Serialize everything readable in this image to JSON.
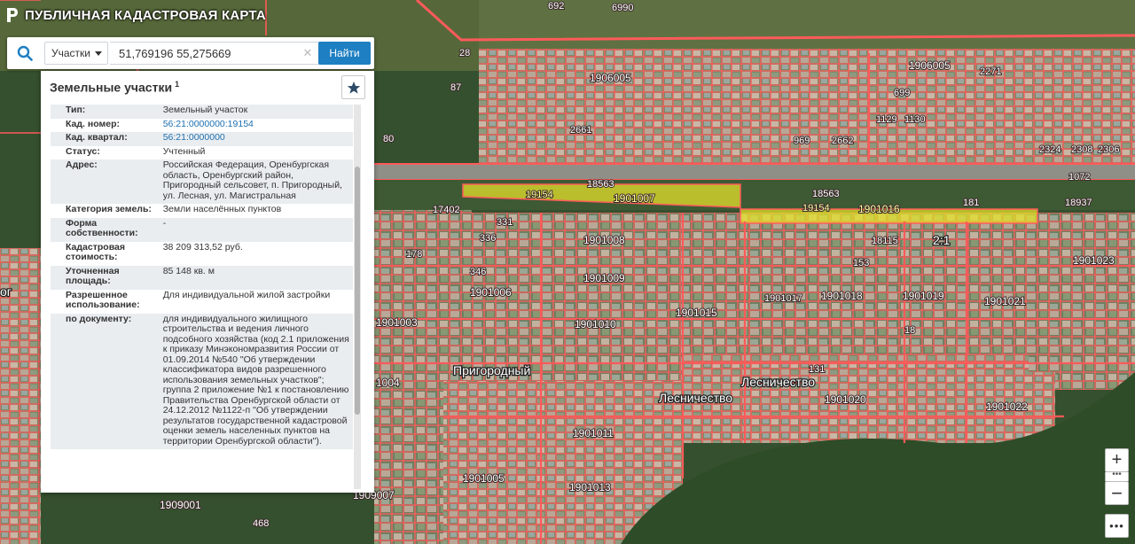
{
  "app": {
    "title": "ПУБЛИЧНАЯ КАДАСТРОВАЯ КАРТА"
  },
  "search": {
    "type_label": "Участки",
    "query": "51,769196 55,275669",
    "find_label": "Найти"
  },
  "panel": {
    "title": "Земельные участки",
    "title_sup": "1",
    "rows": [
      {
        "key": "Тип:",
        "value": "Земельный участок"
      },
      {
        "key": "Кад. номер:",
        "value": "56:21:0000000:19154",
        "link": true
      },
      {
        "key": "Кад. квартал:",
        "value": "56:21:0000000",
        "link": true
      },
      {
        "key": "Статус:",
        "value": "Учтенный"
      },
      {
        "key": "Адрес:",
        "value": "Российская Федерация, Оренбургская область, Оренбургский район, Пригородный сельсовет, п. Пригородный, ул. Лесная, ул. Магистральная"
      },
      {
        "key": "Категория земель:",
        "value": "Земли населённых пунктов"
      },
      {
        "key": "Форма собственности:",
        "value": "-"
      },
      {
        "key": "Кадастровая стоимость:",
        "value": "38 209 313,52 руб."
      },
      {
        "key": "Уточненная площадь:",
        "value": "85 148 кв. м"
      },
      {
        "key": "Разрешенное использование:",
        "value": "Для индивидуальной жилой застройки"
      },
      {
        "key": "по документу:",
        "value": "для индивидуального жилищного строительства и ведения личного подсобного хозяйства (код 2.1 приложения к приказу Минэкономразвития России от 01.09.2014 №540 \"Об утверждении классификатора видов разрешенного использования земельных участков\"; группа 2 приложение №1 к постановлению Правительства Оренбургской области от 24.12.2012 №1122-п \"Об утверждении результатов государственной кадастровой оценки земель населенных пунктов на территории Оренбургской области\")."
      }
    ]
  },
  "map": {
    "parcel_labels": [
      "692",
      "6990",
      "2271",
      "1906005",
      "1906005",
      "699",
      "2661",
      "1129",
      "1130",
      "969",
      "2662",
      "2324",
      "2308",
      "2306",
      "1072",
      "18563",
      "18563",
      "1901007",
      "19154",
      "19154",
      "1901016",
      "181",
      "18937",
      "1901008",
      "18115",
      "2:1",
      "1901023",
      "336",
      "331",
      "346",
      "1901009",
      "153",
      "1901006",
      "1901017",
      "1901018",
      "1901019",
      "1901021",
      "1901003",
      "1901010",
      "1901015",
      "131",
      "1901020",
      "1901022",
      "1004",
      "1901011",
      "1901005",
      "1901013",
      "1909001",
      "1909007",
      "468",
      "87",
      "80",
      "178",
      "17402",
      "28",
      "18"
    ],
    "place_labels": [
      "Пригородный",
      "Лесничество",
      "Лесничество",
      "ог"
    ],
    "colors": {
      "parcel_stroke": "#ff5a5a",
      "selected_fill": "#e4e02a",
      "field": "#5c6e3a",
      "forest": "#2f4d2a",
      "road": "#9a9a96"
    }
  },
  "controls": {
    "zoom_in": "+",
    "zoom_dots": "•••",
    "zoom_out": "−",
    "more": "•••"
  }
}
